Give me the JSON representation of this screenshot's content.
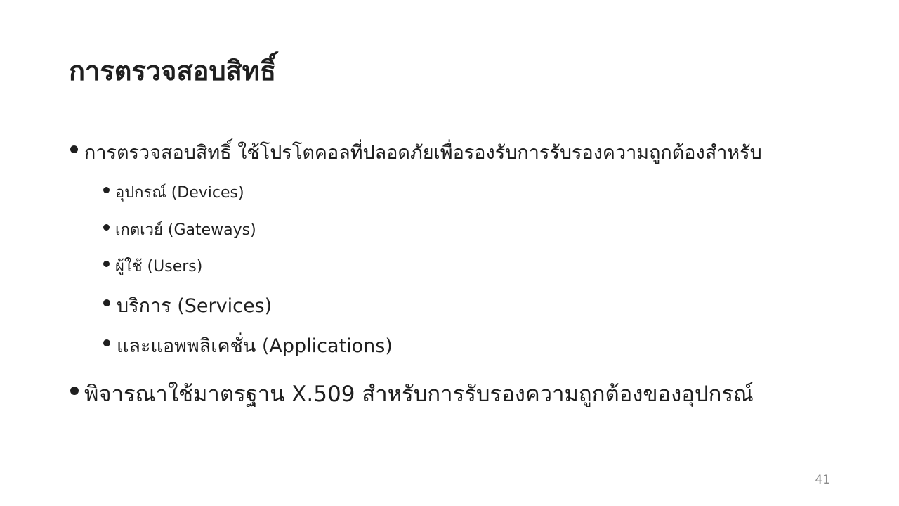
{
  "slide": {
    "title": "การตรวจสอบสิทธิ์",
    "bullets": [
      "การตรวจสอบสิทธิ์ ใช้โปรโตคอลที่ปลอดภัยเพื่อรองรับการรับรองความถูกต้องสำหรับ",
      "อุปกรณ์ (Devices)",
      "เกตเวย์ (Gateways)",
      "ผู้ใช้ (Users)",
      "บริการ (Services)",
      "และแอพพลิเคชั่น (Applications)",
      "พิจารณาใช้มาตรฐาน X.509 สำหรับการรับรองความถูกต้องของอุปกรณ์"
    ],
    "page_number": "41"
  }
}
